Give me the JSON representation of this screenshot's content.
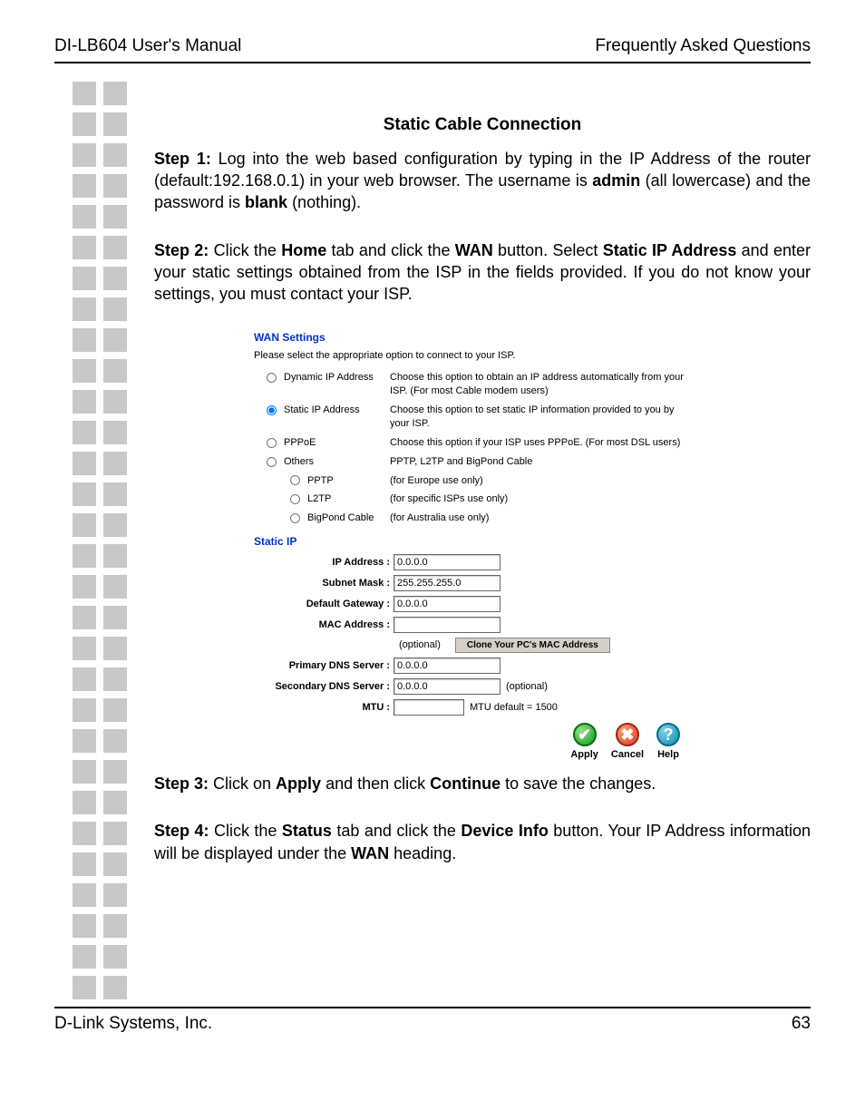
{
  "header": {
    "left": "DI-LB604 User's Manual",
    "right": "Frequently Asked Questions"
  },
  "title": "Static Cable Connection",
  "step1": {
    "label": "Step 1:",
    "t1": " Log into the web based configuration by typing in the IP Address of the router (default:192.168.0.1) in your web browser. The username is ",
    "b1": "admin",
    "t2": " (all lowercase) and the password is ",
    "b2": "blank",
    "t3": " (nothing)."
  },
  "step2": {
    "label": "Step 2:",
    "t1": " Click the ",
    "b1": "Home",
    "t2": " tab and click the ",
    "b2": "WAN",
    "t3": " button. Select ",
    "b3": "Static IP Address",
    "t4": " and enter your static settings obtained from the ISP in the fields provided. If you do not know your settings, you must contact your ISP."
  },
  "wan": {
    "title": "WAN Settings",
    "subtitle": "Please select the appropriate option to connect to your ISP.",
    "options": [
      {
        "label": "Dynamic IP Address",
        "desc": "Choose this option to obtain an IP address automatically from your ISP. (For most Cable modem users)",
        "checked": false
      },
      {
        "label": "Static IP Address",
        "desc": "Choose this option to set static IP information provided to you by your ISP.",
        "checked": true
      },
      {
        "label": "PPPoE",
        "desc": "Choose this option if your ISP uses PPPoE. (For most DSL users)",
        "checked": false
      },
      {
        "label": "Others",
        "desc": "PPTP, L2TP and BigPond Cable",
        "checked": false
      }
    ],
    "suboptions": [
      {
        "label": "PPTP",
        "desc": "(for Europe use only)"
      },
      {
        "label": "L2TP",
        "desc": "(for specific ISPs use only)"
      },
      {
        "label": "BigPond Cable",
        "desc": "(for Australia use only)"
      }
    ]
  },
  "static": {
    "title": "Static IP",
    "fields": {
      "ip_label": "IP Address :",
      "ip_value": "0.0.0.0",
      "mask_label": "Subnet Mask :",
      "mask_value": "255.255.255.0",
      "gw_label": "Default Gateway :",
      "gw_value": "0.0.0.0",
      "mac_label": "MAC Address :",
      "mac_value": "",
      "optional": "(optional)",
      "clone": "Clone Your PC's MAC Address",
      "pdns_label": "Primary DNS Server :",
      "pdns_value": "0.0.0.0",
      "sdns_label": "Secondary DNS Server :",
      "sdns_value": "0.0.0.0",
      "mtu_label": "MTU :",
      "mtu_value": "",
      "mtu_note": "MTU default = 1500"
    }
  },
  "actions": {
    "apply": "Apply",
    "cancel": "Cancel",
    "help": "Help"
  },
  "step3": {
    "label": "Step 3:",
    "t1": " Click on ",
    "b1": "Apply",
    "t2": " and then click ",
    "b2": "Continue",
    "t3": " to save the changes."
  },
  "step4": {
    "label": "Step 4:",
    "t1": " Click the ",
    "b1": "Status",
    "t2": " tab and click the ",
    "b2": "Device Info",
    "t3": " button. Your IP Address information will be displayed under the ",
    "b3": "WAN",
    "t4": " heading."
  },
  "footer": {
    "left": "D-Link Systems, Inc.",
    "right": "63"
  }
}
